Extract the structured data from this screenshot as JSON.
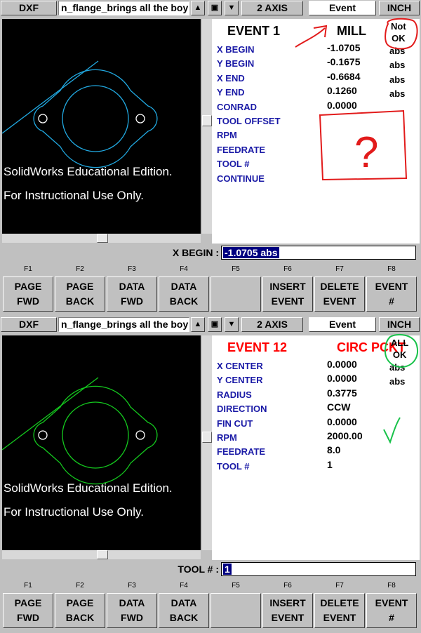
{
  "colors": {
    "annotation_red": "#e21b1b",
    "annotation_green": "#18c24a",
    "label_blue": "#1a1aa6",
    "title_red": "#ff0000",
    "outline1": "#21a8e0",
    "outline2": "#14c81e"
  },
  "panels": [
    {
      "toolbar": {
        "dxf": "DXF",
        "file": "n_flange_brings all the boy",
        "up_icon": "▲",
        "window_icon": "▣",
        "down_icon": "▼",
        "axis": "2 AXIS",
        "mode": "Event",
        "units": "INCH"
      },
      "watermark": {
        "line1": "SolidWorks Educational Edition.",
        "line2": "For Instructional Use Only."
      },
      "event": {
        "title": "EVENT 1",
        "type": "MILL",
        "status_line1": "Not",
        "status_line2": "OK"
      },
      "rows": [
        {
          "label": "X BEGIN",
          "value": "-1.0705",
          "unit": "abs"
        },
        {
          "label": "Y BEGIN",
          "value": "-0.1675",
          "unit": "abs"
        },
        {
          "label": "X END",
          "value": "-0.6684",
          "unit": "abs"
        },
        {
          "label": "Y END",
          "value": "0.1260",
          "unit": "abs"
        },
        {
          "label": "CONRAD",
          "value": "0.0000",
          "unit": ""
        },
        {
          "label": "TOOL OFFSET",
          "value": "",
          "unit": ""
        },
        {
          "label": "RPM",
          "value": "",
          "unit": ""
        },
        {
          "label": "FEEDRATE",
          "value": "",
          "unit": ""
        },
        {
          "label": "TOOL #",
          "value": "",
          "unit": ""
        },
        {
          "label": "CONTINUE",
          "value": "",
          "unit": ""
        }
      ],
      "annotation_text": "?",
      "input": {
        "label": "X BEGIN :",
        "value": "-1.0705   abs"
      }
    },
    {
      "toolbar": {
        "dxf": "DXF",
        "file": "n_flange_brings all the boy",
        "up_icon": "▲",
        "window_icon": "▣",
        "down_icon": "▼",
        "axis": "2 AXIS",
        "mode": "Event",
        "units": "INCH"
      },
      "watermark": {
        "line1": "SolidWorks Educational Edition.",
        "line2": "For Instructional Use Only."
      },
      "event": {
        "title": "EVENT 12",
        "type": "CIRC PCKT",
        "status_line1": "ALL",
        "status_line2": "OK"
      },
      "rows": [
        {
          "label": "X CENTER",
          "value": "0.0000",
          "unit": "abs"
        },
        {
          "label": "Y CENTER",
          "value": "0.0000",
          "unit": "abs"
        },
        {
          "label": "RADIUS",
          "value": "0.3775",
          "unit": ""
        },
        {
          "label": "DIRECTION",
          "value": "CCW",
          "unit": ""
        },
        {
          "label": "FIN CUT",
          "value": "0.0000",
          "unit": ""
        },
        {
          "label": "RPM",
          "value": "2000.00",
          "unit": ""
        },
        {
          "label": "FEEDRATE",
          "value": "8.0",
          "unit": ""
        },
        {
          "label": "TOOL #",
          "value": "1",
          "unit": ""
        }
      ],
      "annotation_text": "√",
      "input": {
        "label": "TOOL # :",
        "value": "1"
      }
    }
  ],
  "fkeys": [
    {
      "key": "F1",
      "line1": "PAGE",
      "line2": "FWD"
    },
    {
      "key": "F2",
      "line1": "PAGE",
      "line2": "BACK"
    },
    {
      "key": "F3",
      "line1": "DATA",
      "line2": "FWD"
    },
    {
      "key": "F4",
      "line1": "DATA",
      "line2": "BACK"
    },
    {
      "key": "F5",
      "line1": "",
      "line2": ""
    },
    {
      "key": "F6",
      "line1": "INSERT",
      "line2": "EVENT"
    },
    {
      "key": "F7",
      "line1": "DELETE",
      "line2": "EVENT"
    },
    {
      "key": "F8",
      "line1": "EVENT",
      "line2": "#"
    }
  ]
}
